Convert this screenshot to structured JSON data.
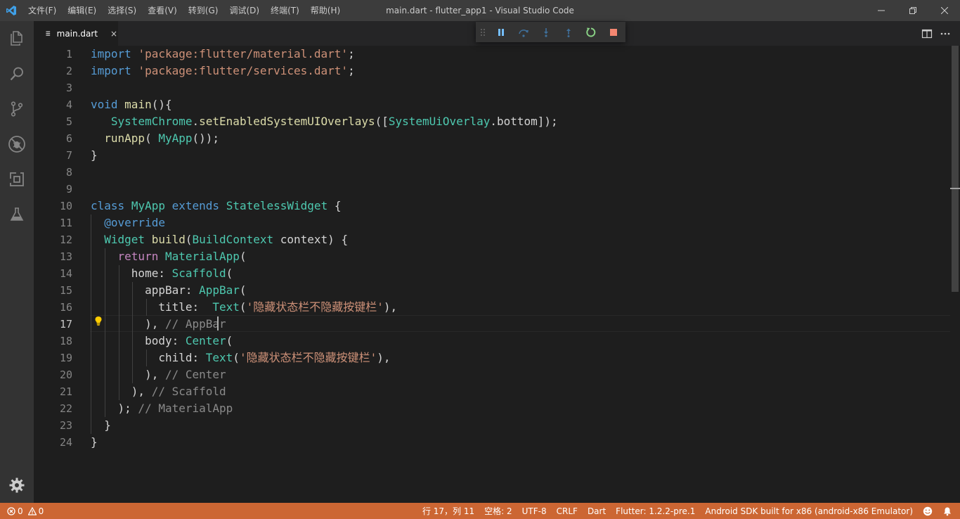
{
  "window": {
    "title": "main.dart - flutter_app1 - Visual Studio Code"
  },
  "menu": [
    "文件(F)",
    "编辑(E)",
    "选择(S)",
    "查看(V)",
    "转到(G)",
    "调试(D)",
    "终端(T)",
    "帮助(H)"
  ],
  "activity_bar": [
    "files-icon",
    "search-icon",
    "source-control-icon",
    "debug-icon",
    "extensions-icon",
    "test-flask-icon",
    "gear-icon"
  ],
  "tab": {
    "label": "main.dart",
    "icon_text": "≡",
    "close": "×"
  },
  "debug_toolbar": [
    "pause-icon",
    "step-over-icon",
    "step-into-icon",
    "step-out-icon",
    "restart-icon",
    "stop-icon"
  ],
  "editor": {
    "active_line": 17,
    "lines": [
      {
        "n": "1",
        "indent": 0,
        "tokens": [
          {
            "t": "import",
            "c": "kw"
          },
          {
            "t": " ",
            "c": "plain"
          },
          {
            "t": "'package:flutter/material.dart'",
            "c": "str"
          },
          {
            "t": ";",
            "c": "plain"
          }
        ]
      },
      {
        "n": "2",
        "indent": 0,
        "tokens": [
          {
            "t": "import",
            "c": "kw"
          },
          {
            "t": " ",
            "c": "plain"
          },
          {
            "t": "'package:flutter/services.dart'",
            "c": "str"
          },
          {
            "t": ";",
            "c": "plain"
          }
        ]
      },
      {
        "n": "3",
        "indent": 0,
        "tokens": []
      },
      {
        "n": "4",
        "indent": 0,
        "tokens": [
          {
            "t": "void",
            "c": "kw"
          },
          {
            "t": " ",
            "c": "plain"
          },
          {
            "t": "main",
            "c": "fn"
          },
          {
            "t": "(){",
            "c": "plain"
          }
        ]
      },
      {
        "n": "5",
        "indent": 0,
        "tokens": [
          {
            "t": "   ",
            "c": "plain"
          },
          {
            "t": "SystemChrome",
            "c": "ty"
          },
          {
            "t": ".",
            "c": "plain"
          },
          {
            "t": "setEnabledSystemUIOverlays",
            "c": "fn"
          },
          {
            "t": "([",
            "c": "plain"
          },
          {
            "t": "SystemUiOverlay",
            "c": "ty"
          },
          {
            "t": ".bottom]);",
            "c": "plain"
          }
        ]
      },
      {
        "n": "6",
        "indent": 0,
        "tokens": [
          {
            "t": "  ",
            "c": "plain"
          },
          {
            "t": "runApp",
            "c": "fn"
          },
          {
            "t": "( ",
            "c": "plain"
          },
          {
            "t": "MyApp",
            "c": "ty"
          },
          {
            "t": "());",
            "c": "plain"
          }
        ]
      },
      {
        "n": "7",
        "indent": 0,
        "tokens": [
          {
            "t": "}",
            "c": "plain"
          }
        ]
      },
      {
        "n": "8",
        "indent": 0,
        "tokens": []
      },
      {
        "n": "9",
        "indent": 0,
        "tokens": []
      },
      {
        "n": "10",
        "indent": 0,
        "tokens": [
          {
            "t": "class",
            "c": "kw"
          },
          {
            "t": " ",
            "c": "plain"
          },
          {
            "t": "MyApp",
            "c": "ty"
          },
          {
            "t": " ",
            "c": "plain"
          },
          {
            "t": "extends",
            "c": "kw"
          },
          {
            "t": " ",
            "c": "plain"
          },
          {
            "t": "StatelessWidget",
            "c": "ty"
          },
          {
            "t": " {",
            "c": "plain"
          }
        ]
      },
      {
        "n": "11",
        "indent": 1,
        "tokens": [
          {
            "t": "  ",
            "c": "plain"
          },
          {
            "t": "@override",
            "c": "kw"
          }
        ]
      },
      {
        "n": "12",
        "indent": 1,
        "tokens": [
          {
            "t": "  ",
            "c": "plain"
          },
          {
            "t": "Widget",
            "c": "ty"
          },
          {
            "t": " ",
            "c": "plain"
          },
          {
            "t": "build",
            "c": "fn"
          },
          {
            "t": "(",
            "c": "plain"
          },
          {
            "t": "BuildContext",
            "c": "ty"
          },
          {
            "t": " context) {",
            "c": "plain"
          }
        ]
      },
      {
        "n": "13",
        "indent": 2,
        "tokens": [
          {
            "t": "    ",
            "c": "plain"
          },
          {
            "t": "return",
            "c": "kwc"
          },
          {
            "t": " ",
            "c": "plain"
          },
          {
            "t": "MaterialApp",
            "c": "ty"
          },
          {
            "t": "(",
            "c": "plain"
          }
        ]
      },
      {
        "n": "14",
        "indent": 3,
        "tokens": [
          {
            "t": "      home: ",
            "c": "plain"
          },
          {
            "t": "Scaffold",
            "c": "ty"
          },
          {
            "t": "(",
            "c": "plain"
          }
        ]
      },
      {
        "n": "15",
        "indent": 4,
        "tokens": [
          {
            "t": "        appBar: ",
            "c": "plain"
          },
          {
            "t": "AppBar",
            "c": "ty"
          },
          {
            "t": "(",
            "c": "plain"
          }
        ]
      },
      {
        "n": "16",
        "indent": 5,
        "tokens": [
          {
            "t": "          title:  ",
            "c": "plain"
          },
          {
            "t": "Text",
            "c": "ty"
          },
          {
            "t": "(",
            "c": "plain"
          },
          {
            "t": "'隐藏状态栏不隐藏按键栏'",
            "c": "str"
          },
          {
            "t": "),",
            "c": "plain"
          }
        ]
      },
      {
        "n": "17",
        "indent": 4,
        "tokens": [
          {
            "t": "        ),",
            "c": "plain"
          },
          {
            "t": " // AppBar",
            "c": "com2"
          }
        ]
      },
      {
        "n": "18",
        "indent": 4,
        "tokens": [
          {
            "t": "        body: ",
            "c": "plain"
          },
          {
            "t": "Center",
            "c": "ty"
          },
          {
            "t": "(",
            "c": "plain"
          }
        ]
      },
      {
        "n": "19",
        "indent": 5,
        "tokens": [
          {
            "t": "          child: ",
            "c": "plain"
          },
          {
            "t": "Text",
            "c": "ty"
          },
          {
            "t": "(",
            "c": "plain"
          },
          {
            "t": "'隐藏状态栏不隐藏按键栏'",
            "c": "str"
          },
          {
            "t": "),",
            "c": "plain"
          }
        ]
      },
      {
        "n": "20",
        "indent": 4,
        "tokens": [
          {
            "t": "        ),",
            "c": "plain"
          },
          {
            "t": " // Center",
            "c": "com2"
          }
        ]
      },
      {
        "n": "21",
        "indent": 3,
        "tokens": [
          {
            "t": "      ),",
            "c": "plain"
          },
          {
            "t": " // Scaffold",
            "c": "com2"
          }
        ]
      },
      {
        "n": "22",
        "indent": 2,
        "tokens": [
          {
            "t": "    );",
            "c": "plain"
          },
          {
            "t": " // MaterialApp",
            "c": "com2"
          }
        ]
      },
      {
        "n": "23",
        "indent": 1,
        "tokens": [
          {
            "t": "  }",
            "c": "plain"
          }
        ]
      },
      {
        "n": "24",
        "indent": 0,
        "tokens": [
          {
            "t": "}",
            "c": "plain"
          }
        ]
      }
    ]
  },
  "statusbar": {
    "errors": "0",
    "warnings": "0",
    "position": "行 17，列 11",
    "spaces": "空格: 2",
    "encoding": "UTF-8",
    "eol": "CRLF",
    "language": "Dart",
    "flutter": "Flutter: 1.2.2-pre.1",
    "device": "Android SDK built for x86 (android-x86 Emulator)"
  },
  "colors": {
    "statusbar": "#cc6633",
    "titlebar": "#3c3c3c",
    "activitybar": "#333333",
    "editor_bg": "#1e1e1e"
  }
}
